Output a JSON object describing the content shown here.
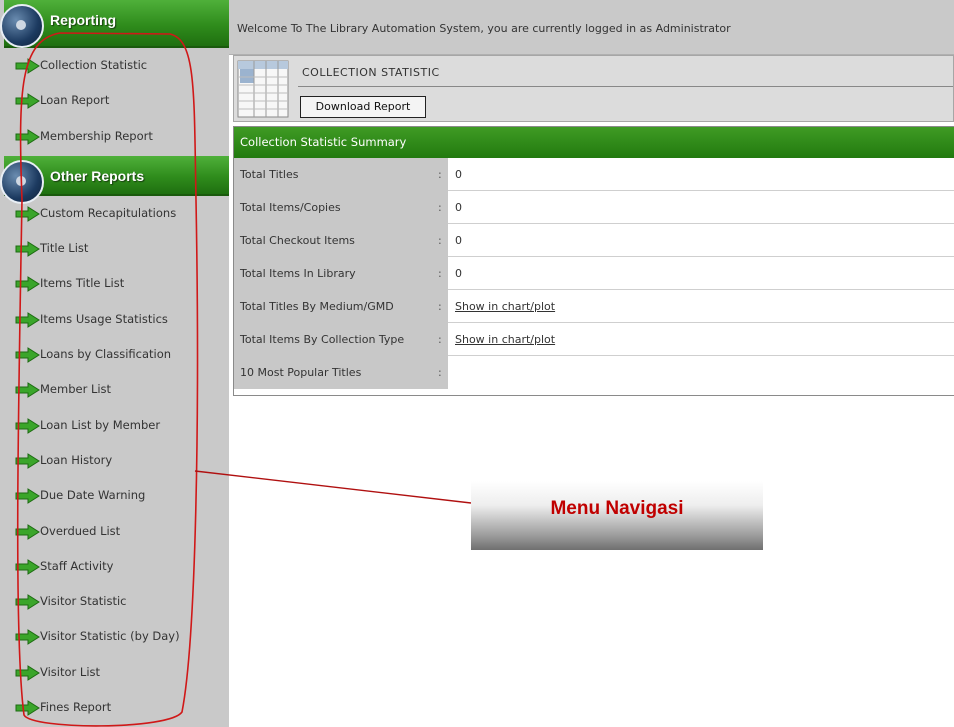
{
  "header": {
    "welcome": "Welcome To The Library Automation System, you are currently logged in as Administrator"
  },
  "sidebar": {
    "sections": [
      {
        "title": "Reporting",
        "items": [
          {
            "label": "Collection Statistic"
          },
          {
            "label": "Loan Report"
          },
          {
            "label": "Membership Report"
          }
        ]
      },
      {
        "title": "Other Reports",
        "items": [
          {
            "label": "Custom Recapitulations"
          },
          {
            "label": "Title List"
          },
          {
            "label": "Items Title List"
          },
          {
            "label": "Items Usage Statistics"
          },
          {
            "label": "Loans by Classification"
          },
          {
            "label": "Member List"
          },
          {
            "label": "Loan List by Member"
          },
          {
            "label": "Loan History"
          },
          {
            "label": "Due Date Warning"
          },
          {
            "label": "Overdued List"
          },
          {
            "label": "Staff Activity"
          },
          {
            "label": "Visitor Statistic"
          },
          {
            "label": "Visitor Statistic (by Day)"
          },
          {
            "label": "Visitor List"
          },
          {
            "label": "Fines Report"
          }
        ]
      }
    ]
  },
  "page": {
    "title": "COLLECTION STATISTIC",
    "download_label": "Download Report"
  },
  "summary": {
    "header": "Collection Statistic Summary",
    "rows": [
      {
        "label": "Total Titles",
        "value": "0"
      },
      {
        "label": "Total Items/Copies",
        "value": "0"
      },
      {
        "label": "Total Checkout Items",
        "value": "0"
      },
      {
        "label": "Total Items In Library",
        "value": "0"
      },
      {
        "label": "Total Titles By Medium/GMD",
        "value": "Show in chart/plot"
      },
      {
        "label": "Total Items By Collection Type",
        "value": "Show in chart/plot"
      },
      {
        "label": "10 Most Popular Titles",
        "value": ""
      }
    ]
  },
  "annotation": {
    "label": "Menu Navigasi"
  },
  "colors": {
    "sidebar_bg": "#c9c9c9",
    "section_green": "#2f8c1c",
    "annotation_red": "#c00000"
  },
  "icons": {
    "menu_item": "green-arrow-icon",
    "section": "globe-icon",
    "title": "spreadsheet-icon"
  }
}
